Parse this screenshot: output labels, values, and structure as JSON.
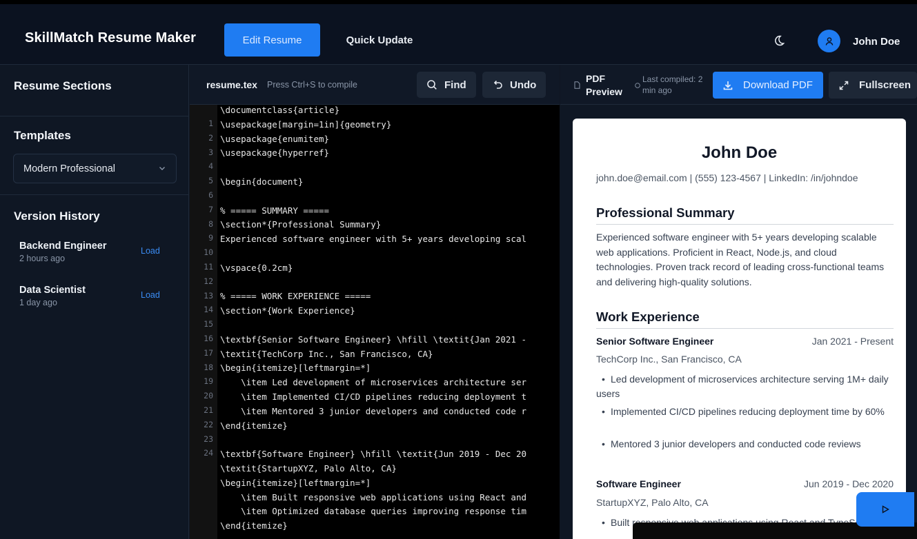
{
  "header": {
    "brand": "SkillMatch Resume Maker",
    "nav": {
      "edit": "Edit Resume",
      "quick": "Quick Update"
    },
    "user": "John Doe"
  },
  "sidebar": {
    "sections_title": "Resume Sections",
    "templates_title": "Templates",
    "template_selected": "Modern Professional",
    "history_title": "Version History",
    "history": [
      {
        "name": "Backend Engineer",
        "time": "2 hours ago",
        "action": "Load"
      },
      {
        "name": "Data Scientist",
        "time": "1 day ago",
        "action": "Load"
      }
    ]
  },
  "editor": {
    "filename": "resume.tex",
    "hint": "Press Ctrl+S to compile",
    "find": "Find",
    "undo": "Undo",
    "line_numbers": [
      "1",
      "2",
      "3",
      "4",
      "5",
      "6",
      "7",
      "8",
      "9",
      "10",
      "11",
      "12",
      "13",
      "14",
      "15",
      "16",
      "17",
      "18",
      "19",
      "20",
      "21",
      "22",
      "23",
      "24"
    ],
    "lines": [
      "\\documentclass{article}",
      "\\usepackage[margin=1in]{geometry}",
      "\\usepackage{enumitem}",
      "\\usepackage{hyperref}",
      "",
      "\\begin{document}",
      "",
      "% ===== SUMMARY =====",
      "\\section*{Professional Summary}",
      "Experienced software engineer with 5+ years developing scal",
      "",
      "\\vspace{0.2cm}",
      "",
      "% ===== WORK EXPERIENCE =====",
      "\\section*{Work Experience}",
      "",
      "\\textbf{Senior Software Engineer} \\hfill \\textit{Jan 2021 -",
      "\\textit{TechCorp Inc., San Francisco, CA}",
      "\\begin{itemize}[leftmargin=*]",
      "    \\item Led development of microservices architecture ser",
      "    \\item Implemented CI/CD pipelines reducing deployment t",
      "    \\item Mentored 3 junior developers and conducted code r",
      "\\end{itemize}",
      "",
      "\\textbf{Software Engineer} \\hfill \\textit{Jun 2019 - Dec 20",
      "\\textit{StartupXYZ, Palo Alto, CA}",
      "\\begin{itemize}[leftmargin=*]",
      "    \\item Built responsive web applications using React and",
      "    \\item Optimized database queries improving response tim",
      "\\end{itemize}"
    ]
  },
  "preview": {
    "title": "PDF Preview",
    "compiled": "Last compiled: 2 min ago",
    "download": "Download PDF",
    "fullscreen": "Fullscreen",
    "resume": {
      "name": "John Doe",
      "contact": "john.doe@email.com | (555) 123-4567 | LinkedIn: /in/johndoe",
      "summary_heading": "Professional Summary",
      "summary": "Experienced software engineer with 5+ years developing scalable web applications. Proficient in React, Node.js, and cloud technologies. Proven track record of leading cross-functional teams and delivering high-quality solutions.",
      "experience_heading": "Work Experience",
      "jobs": [
        {
          "title": "Senior Software Engineer",
          "dates": "Jan 2021 - Present",
          "company": "TechCorp Inc., San Francisco, CA",
          "bullets": [
            "Led development of microservices architecture serving 1M+ daily users",
            "Implemented CI/CD pipelines reducing deployment time by 60%",
            "Mentored 3 junior developers and conducted code reviews"
          ]
        },
        {
          "title": "Software Engineer",
          "dates": "Jun 2019 - Dec 2020",
          "company": "StartupXYZ, Palo Alto, CA",
          "bullets": [
            "Built responsive web applications using React and TypeScript"
          ]
        }
      ]
    }
  },
  "colors": {
    "accent": "#1f7cf2",
    "background": "#0f1724",
    "editor_bg": "#000000"
  },
  "icons": [
    "moon-icon",
    "user-icon",
    "chevron-down-icon",
    "search-icon",
    "undo-icon",
    "document-icon",
    "clock-icon",
    "download-icon",
    "expand-icon",
    "play-icon"
  ]
}
